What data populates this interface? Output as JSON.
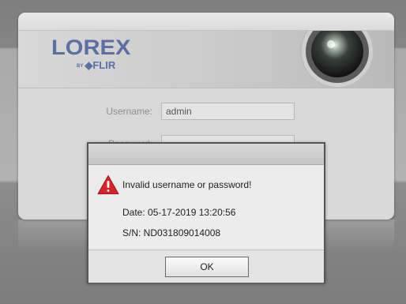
{
  "brand": {
    "name": "LOREX",
    "partner_prefix": "BY",
    "partner": "FLIR"
  },
  "login": {
    "username_label": "Username:",
    "username_value": "admin",
    "password_label": "Password:",
    "password_value": ""
  },
  "dialog": {
    "message": "Invalid username or password!",
    "date_line": "Date: 05-17-2019 13:20:56",
    "serial_line": "S/N: ND031809014008",
    "ok_label": "OK",
    "icon": "warning-icon"
  },
  "colors": {
    "brand_blue": "#5b6fa0",
    "warning_red": "#d8232a"
  }
}
